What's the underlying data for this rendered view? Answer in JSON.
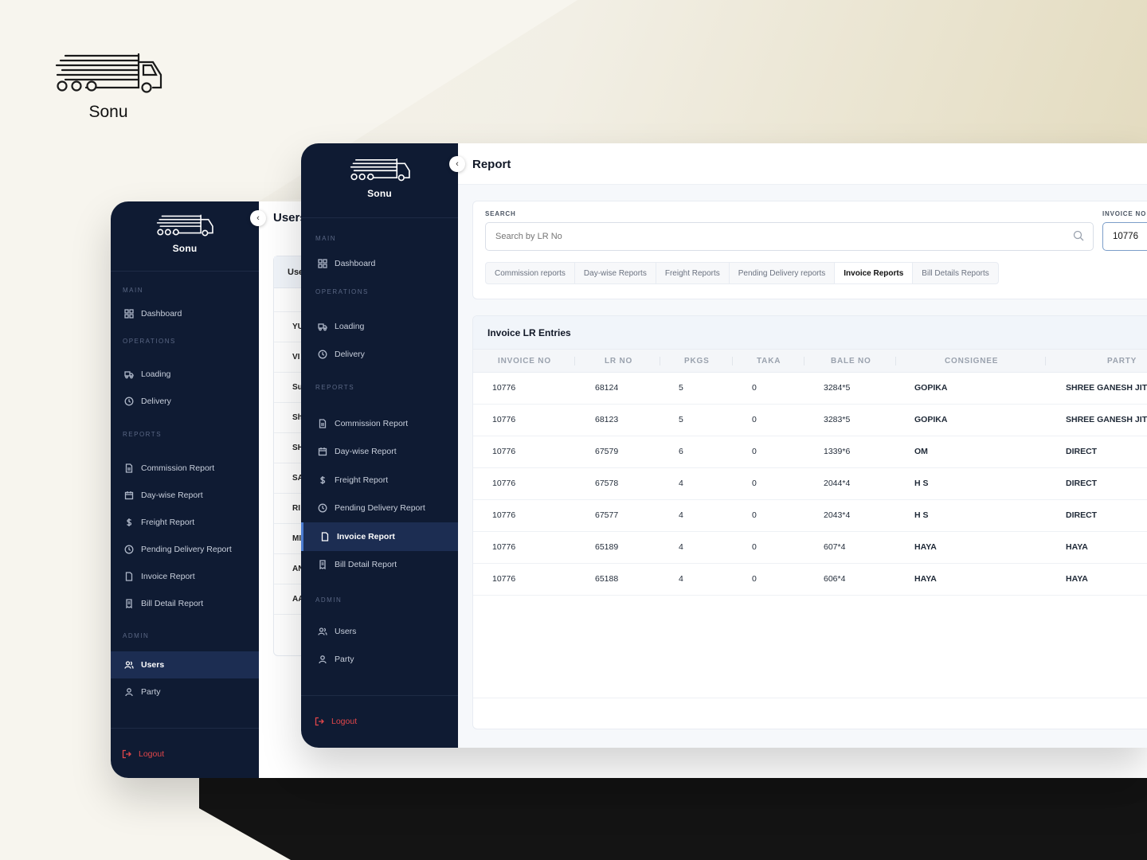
{
  "brand": {
    "name": "Sonu"
  },
  "back_window": {
    "sidebar": {
      "app_name": "Sonu",
      "sections": [
        {
          "title": "MAIN",
          "items": [
            {
              "label": "Dashboard",
              "icon": "grid-icon"
            }
          ]
        },
        {
          "title": "OPERATIONS",
          "items": [
            {
              "label": "Loading",
              "icon": "truck-icon"
            },
            {
              "label": "Delivery",
              "icon": "clock-icon"
            }
          ]
        },
        {
          "title": "REPORTS",
          "items": [
            {
              "label": "Commission Report",
              "icon": "file-icon"
            },
            {
              "label": "Day-wise Report",
              "icon": "calendar-icon"
            },
            {
              "label": "Freight Report",
              "icon": "dollar-icon"
            },
            {
              "label": "Pending Delivery Report",
              "icon": "clock-icon"
            },
            {
              "label": "Invoice Report",
              "icon": "file-icon"
            },
            {
              "label": "Bill Detail Report",
              "icon": "bill-icon"
            }
          ]
        },
        {
          "title": "ADMIN",
          "items": [
            {
              "label": "Users",
              "icon": "users-icon"
            },
            {
              "label": "Party",
              "icon": "user-icon"
            }
          ]
        }
      ],
      "active": "Users",
      "logout": "Logout"
    },
    "title": "Users",
    "card_header": "Use",
    "rows": [
      "YU",
      "VI",
      "Su",
      "Sh",
      "SH",
      "SA",
      "RI",
      "MI",
      "AN",
      "AA"
    ]
  },
  "front_window": {
    "sidebar": {
      "app_name": "Sonu",
      "sections": [
        {
          "title": "MAIN",
          "items": [
            {
              "label": "Dashboard",
              "icon": "grid-icon"
            }
          ]
        },
        {
          "title": "OPERATIONS",
          "items": [
            {
              "label": "Loading",
              "icon": "truck-icon"
            },
            {
              "label": "Delivery",
              "icon": "clock-icon"
            }
          ]
        },
        {
          "title": "REPORTS",
          "items": [
            {
              "label": "Commission Report",
              "icon": "file-icon"
            },
            {
              "label": "Day-wise Report",
              "icon": "calendar-icon"
            },
            {
              "label": "Freight Report",
              "icon": "dollar-icon"
            },
            {
              "label": "Pending Delivery Report",
              "icon": "clock-icon"
            },
            {
              "label": "Invoice Report",
              "icon": "file-icon"
            },
            {
              "label": "Bill Detail Report",
              "icon": "bill-icon"
            }
          ]
        },
        {
          "title": "ADMIN",
          "items": [
            {
              "label": "Users",
              "icon": "users-icon"
            },
            {
              "label": "Party",
              "icon": "user-icon"
            }
          ]
        }
      ],
      "active": "Invoice Report",
      "logout": "Logout"
    },
    "page_title": "Report",
    "search": {
      "label": "SEARCH",
      "placeholder": "Search by LR No",
      "value": ""
    },
    "invoice_no": {
      "label": "INVOICE NO",
      "value": "10776"
    },
    "tabs": [
      "Commission reports",
      "Day-wise Reports",
      "Freight Reports",
      "Pending Delivery reports",
      "Invoice Reports",
      "Bill Details Reports"
    ],
    "active_tab": "Invoice Reports",
    "table": {
      "title": "Invoice LR Entries",
      "columns": [
        "INVOICE NO",
        "LR NO",
        "PKGS",
        "TAKA",
        "BALE NO",
        "CONSIGNEE",
        "PARTY"
      ],
      "rows": [
        [
          "10776",
          "68124",
          "5",
          "0",
          "3284*5",
          "GOPIKA",
          "SHREE GANESH JITU"
        ],
        [
          "10776",
          "68123",
          "5",
          "0",
          "3283*5",
          "GOPIKA",
          "SHREE GANESH JITU"
        ],
        [
          "10776",
          "67579",
          "6",
          "0",
          "1339*6",
          "OM",
          "DIRECT"
        ],
        [
          "10776",
          "67578",
          "4",
          "0",
          "2044*4",
          "H S",
          "DIRECT"
        ],
        [
          "10776",
          "67577",
          "4",
          "0",
          "2043*4",
          "H S",
          "DIRECT"
        ],
        [
          "10776",
          "65189",
          "4",
          "0",
          "607*4",
          "HAYA",
          "HAYA"
        ],
        [
          "10776",
          "65188",
          "4",
          "0",
          "606*4",
          "HAYA",
          "HAYA"
        ]
      ]
    }
  }
}
